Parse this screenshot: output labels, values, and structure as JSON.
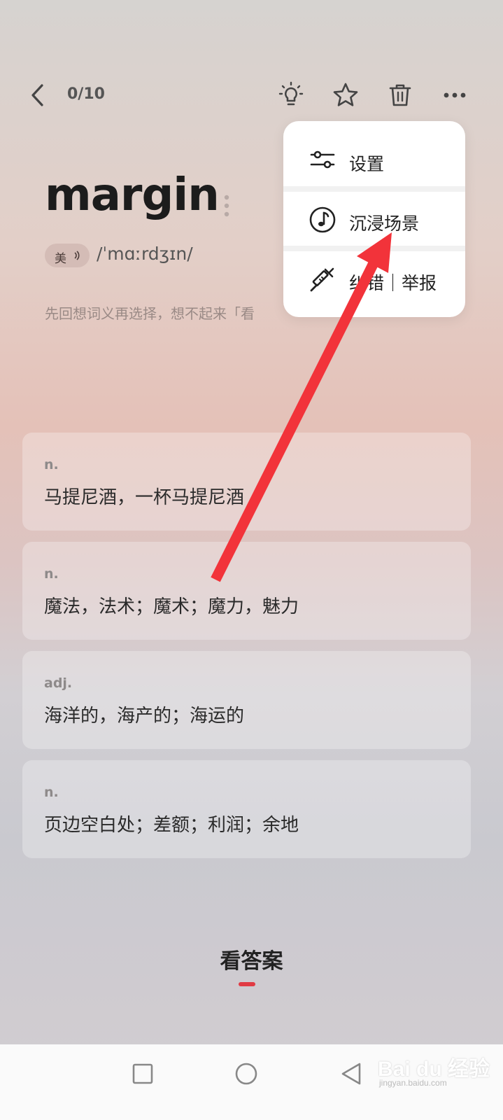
{
  "header": {
    "progress": "0/10",
    "icons": [
      "back-icon",
      "lightbulb-icon",
      "star-icon",
      "trash-icon",
      "more-icon"
    ]
  },
  "word": {
    "text": "margin",
    "accent": "美",
    "phonetic": "/ˈmɑːrdʒɪn/",
    "hint": "先回想词义再选择，想不起来「看"
  },
  "options": [
    {
      "pos": "n.",
      "meaning": "马提尼酒，一杯马提尼酒"
    },
    {
      "pos": "n.",
      "meaning": "魔法，法术；魔术；魔力，魅力"
    },
    {
      "pos": "adj.",
      "meaning": "海洋的，海产的；海运的"
    },
    {
      "pos": "n.",
      "meaning": "页边空白处；差额；利润；余地"
    }
  ],
  "answer_button": "看答案",
  "menu": {
    "items": [
      {
        "label": "设置",
        "icon": "sliders-icon"
      },
      {
        "label": "沉浸场景",
        "icon": "music-note-icon"
      },
      {
        "label": "纠错｜举报",
        "icon": "syringe-icon"
      }
    ]
  },
  "watermark": {
    "text": "Bai du 经验",
    "sub": "jingyan.baidu.com"
  },
  "colors": {
    "accent_red": "#e13a43",
    "arrow_red": "#f2333a"
  }
}
